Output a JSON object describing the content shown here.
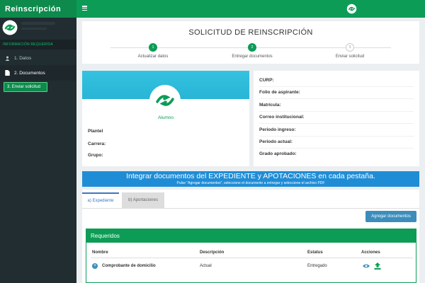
{
  "app": {
    "brand": "Reinscripción"
  },
  "sidebar": {
    "header": "INFORMACIÓN REQUERIDA",
    "items": [
      {
        "label": "1. Datos",
        "icon": "user-icon"
      },
      {
        "label": "2. Documentos",
        "icon": "file-icon"
      }
    ],
    "action_button": "3. Enviar solicitud"
  },
  "wizard": {
    "title": "SOLICITUD DE REINSCRIPCIÓN",
    "steps": [
      {
        "label": "Actualizar datos",
        "number": "1",
        "status": "done"
      },
      {
        "label": "Entregar documentos",
        "number": "2",
        "status": "done"
      },
      {
        "label": "Enviar solicitud",
        "number": "3",
        "status": "todo"
      }
    ]
  },
  "profile": {
    "role": "Alumno",
    "fields": [
      "Plantel",
      "Carrera:",
      "Grupo:"
    ]
  },
  "info": {
    "fields": [
      "CURP:",
      "Folio de aspirante:",
      "Matrícula:",
      "Correo institucional:",
      "Periodo ingreso:",
      "Periodo actual:",
      "Grado aprobado:"
    ]
  },
  "banner": {
    "title": "Integrar documentos del EXPEDIENTE y APOTACIONES en cada pestaña.",
    "subtitle": "Pulse \"Agregar documentos\", seleccione el documento a entregar y seleccione el archivo PDF"
  },
  "tabs": [
    {
      "label": "a) Expediente",
      "active": true
    },
    {
      "label": "b) Aportaciones",
      "active": false
    }
  ],
  "add_button": "Agregar documentos",
  "requeridos": {
    "title": "Requeridos",
    "columns": [
      "Nombre",
      "Descripción",
      "Estatus",
      "Acciones"
    ],
    "rows": [
      {
        "nombre": "Comprobante de domicilio",
        "descripcion": "Actual",
        "estatus": "Entregado"
      }
    ]
  },
  "colors": {
    "primary": "#0d9c56",
    "sidebar": "#222d32",
    "banner": "#1f8dd6",
    "profile_banner": "#2bc0e4",
    "button": "#3c8dbc"
  }
}
